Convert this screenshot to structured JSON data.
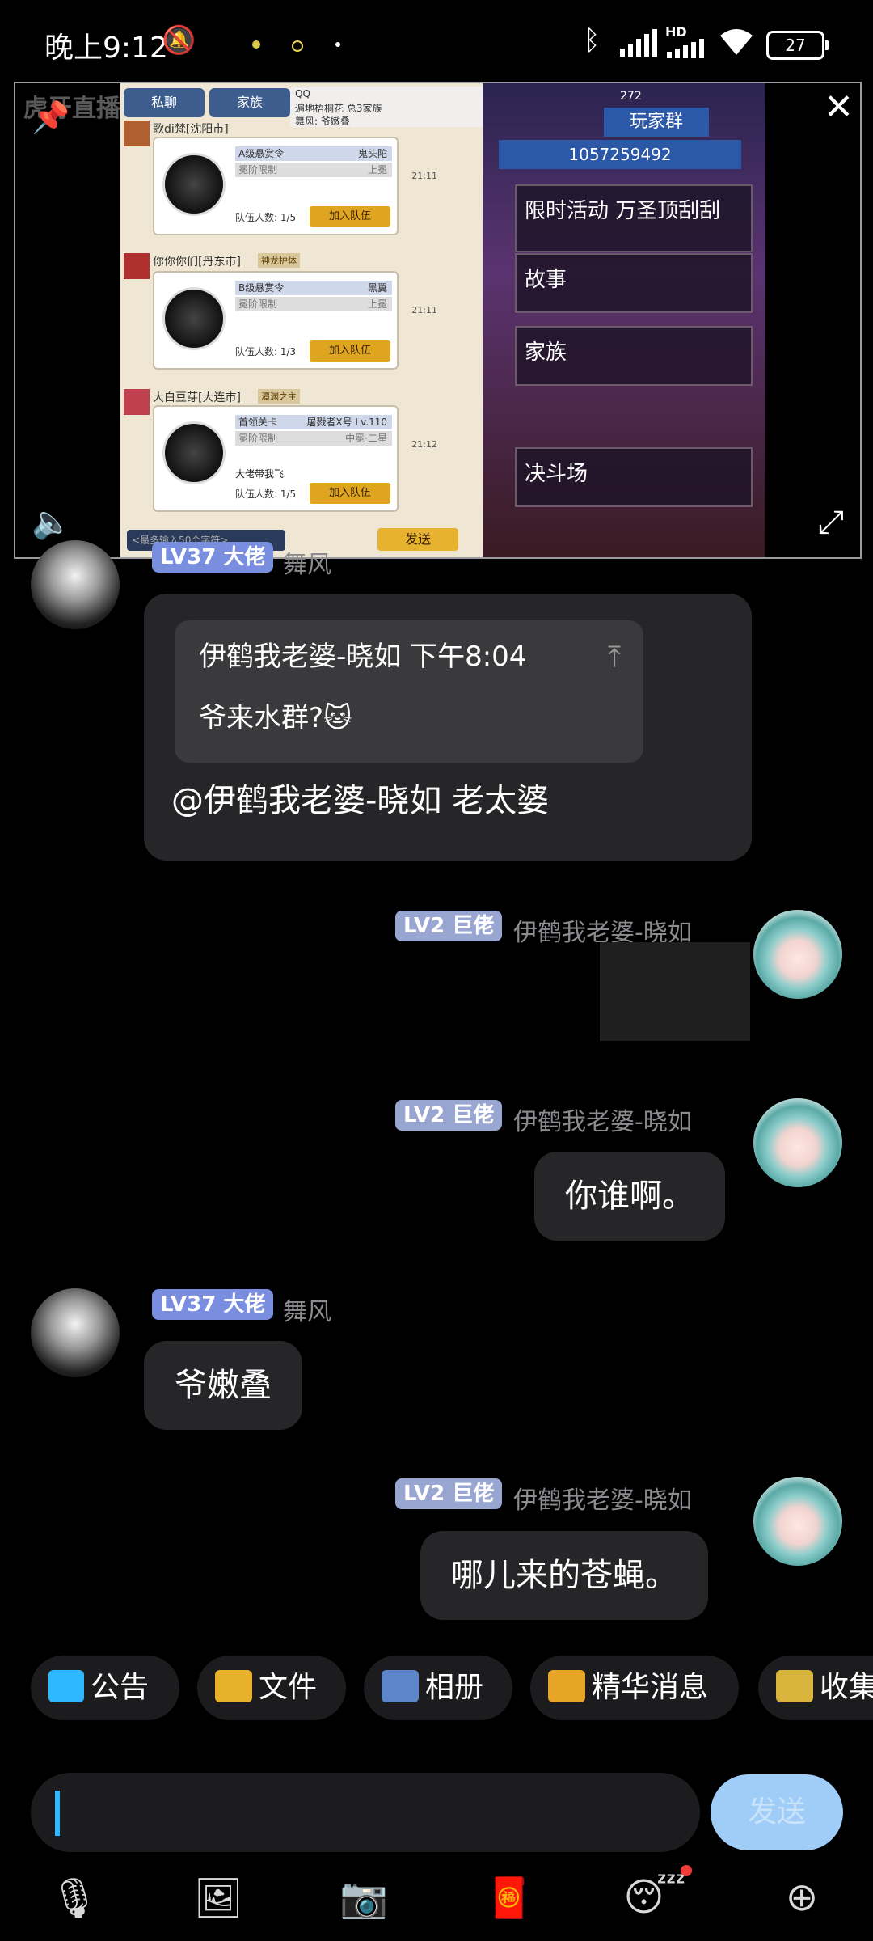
{
  "status_bar": {
    "time": "晚上9:12",
    "hd": "HD",
    "battery": "27"
  },
  "video": {
    "watermark": "虎牙直播",
    "game": {
      "tabs": [
        "私聊",
        "家族"
      ],
      "qq_title": "QQ",
      "qq_subtitle": "遍地梧桐花 总3家族",
      "qq_line2": "舞风: 爷嫩叠",
      "header_right_number": "272",
      "family_group_label": "玩家群",
      "group_id": "1057259492",
      "messages": [
        {
          "sender": "歌di梵[沈阳市]",
          "line1": "A级悬赏令",
          "line1_right": "鬼头陀",
          "line2": "冕阶限制",
          "line2_right": "上冕",
          "count": "队伍人数: 1/5",
          "time": "21:11",
          "join": "加入队伍"
        },
        {
          "sender": "你你你们[丹东市]",
          "badge": "神龙护体",
          "line1": "B级悬赏令",
          "line1_right": "黑翼",
          "line2": "冕阶限制",
          "line2_right": "上冕",
          "count": "队伍人数: 1/3",
          "time": "21:11",
          "join": "加入队伍"
        },
        {
          "sender": "大白豆芽[大连市]",
          "badge": "潭渊之主",
          "line1": "首领关卡",
          "line1_right": "屠戮者X号 Lv.110",
          "line2": "冕阶限制",
          "line2_right": "中冕·二星",
          "extra": "大佬带我飞",
          "count": "队伍人数: 1/5",
          "time": "21:12",
          "join": "加入队伍"
        }
      ],
      "input_placeholder": "<最多输入50个字符>",
      "send_label": "发送",
      "panels": [
        "限时活动 万圣顶刮刮",
        "故事",
        "家族",
        "决斗场"
      ]
    }
  },
  "chat": {
    "messages": [
      {
        "level": "LV37",
        "title": "大佬",
        "sender": "舞风",
        "quote_sender": "伊鹤我老婆-晓如",
        "quote_time": "下午8:04",
        "quote_text": "爷来水群?🐱",
        "text": "@伊鹤我老婆-晓如 老太婆"
      },
      {
        "level": "LV2",
        "title": "巨佬",
        "sender": "伊鹤我老婆-晓如"
      },
      {
        "level": "LV2",
        "title": "巨佬",
        "sender": "伊鹤我老婆-晓如",
        "text": "你谁啊。"
      },
      {
        "level": "LV37",
        "title": "大佬",
        "sender": "舞风",
        "text": "爷嫩叠"
      },
      {
        "level": "LV2",
        "title": "巨佬",
        "sender": "伊鹤我老婆-晓如",
        "text": "哪儿来的苍蝇。"
      }
    ]
  },
  "quick_actions": [
    {
      "label": "公告",
      "icon": "megaphone-icon"
    },
    {
      "label": "文件",
      "icon": "folder-icon"
    },
    {
      "label": "相册",
      "icon": "photo-album-icon"
    },
    {
      "label": "精华消息",
      "icon": "essence-icon"
    },
    {
      "label": "收集",
      "icon": "collect-icon"
    }
  ],
  "composer": {
    "send_label": "发送"
  },
  "colors": {
    "accent": "#2fb8ff",
    "send_button": "#9fcdf8",
    "lv37_badge": "#7a8ee0",
    "lv2_badge": "#9aa6d2",
    "bubble": "#262628"
  }
}
